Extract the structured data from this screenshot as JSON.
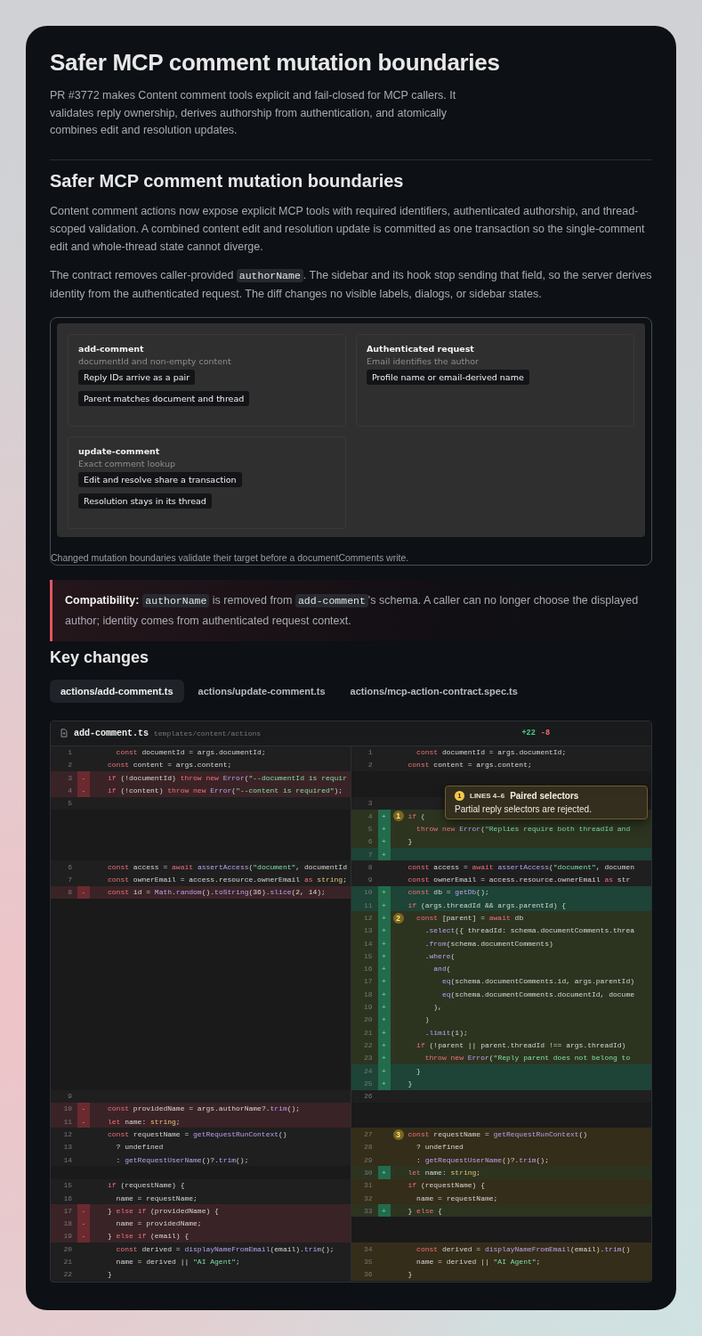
{
  "page": {
    "title": "Safer MCP comment mutation boundaries",
    "summary": "PR #3772 makes Content comment tools explicit and fail-closed for MCP callers. It validates reply ownership, derives authorship from authentication, and atomically combines edit and resolution updates."
  },
  "section": {
    "heading": "Safer MCP comment mutation boundaries",
    "paragraphs": [
      [
        {
          "kind": "text",
          "text": "Content comment actions now expose explicit MCP tools with required identifiers, authenticated authorship, and thread-scoped validation. A combined content edit and resolution update is committed as one transaction so the single-comment edit and whole-thread state cannot diverge."
        }
      ],
      [
        {
          "kind": "text",
          "text": "The contract removes caller-provided "
        },
        {
          "kind": "code",
          "text": "authorName"
        },
        {
          "kind": "text",
          "text": ". The sidebar and its hook stop sending that field, so the server derives identity from the authenticated request. The diff changes no visible labels, dialogs, or sidebar states."
        }
      ]
    ]
  },
  "diagram": {
    "cards": [
      {
        "title": "add-comment",
        "subtitle": "documentId and non-empty content",
        "chips": [
          "Reply IDs arrive as a pair",
          "Parent matches document and thread"
        ]
      },
      {
        "title": "Authenticated request",
        "subtitle": "Email identifies the author",
        "chips": [
          "Profile name or email-derived name"
        ]
      },
      {
        "title": "update-comment",
        "subtitle": "Exact comment lookup",
        "chips": [
          "Edit and resolve share a transaction",
          "Resolution stays in its thread"
        ]
      }
    ],
    "caption": "Changed mutation boundaries validate their target before a documentComments write."
  },
  "callout": {
    "segments": [
      {
        "kind": "bold",
        "text": "Compatibility:"
      },
      {
        "kind": "code",
        "text": "authorName"
      },
      {
        "kind": "text",
        "text": " is removed from "
      },
      {
        "kind": "code",
        "text": "add-comment"
      },
      {
        "kind": "text",
        "text": "'s schema. A caller can no longer choose the displayed author; identity comes from authenticated request context."
      }
    ]
  },
  "key_changes": {
    "heading": "Key changes",
    "tabs": [
      {
        "label": "actions/add-comment.ts",
        "selected": true
      },
      {
        "label": "actions/update-comment.ts",
        "selected": false
      },
      {
        "label": "actions/mcp-action-contract.spec.ts",
        "selected": false
      }
    ]
  },
  "diff": {
    "file_name": "add-comment.ts",
    "path": "templates/content/actions",
    "additions": "+22",
    "deletions": "-8",
    "tooltip": {
      "marker": "1",
      "lines_label": "LINES 4–6",
      "title": "Paired selectors",
      "body": "Partial reply selectors are rejected."
    },
    "rows": [
      {
        "left": {
          "kind": "ctx",
          "num": "1",
          "code": "  const documentId = args.documentId;"
        },
        "right": {
          "kind": "ctx",
          "num": "1",
          "code": "  const documentId = args.documentId;"
        }
      },
      {
        "left": {
          "kind": "ctx",
          "num": "2",
          "code": "const content = args.content;"
        },
        "right": {
          "kind": "ctx",
          "num": "2",
          "code": "const content = args.content;"
        }
      },
      {
        "left": {
          "kind": "del",
          "num": "3",
          "sign": "-",
          "code": "if (!documentId) throw new Error(\"--documentId is requir"
        },
        "right": {
          "kind": "empty"
        }
      },
      {
        "left": {
          "kind": "del",
          "num": "4",
          "sign": "-",
          "code": "if (!content) throw new Error(\"--content is required\");"
        },
        "right": {
          "kind": "empty"
        }
      },
      {
        "left": {
          "kind": "ctx",
          "num": "5"
        },
        "right": {
          "kind": "ctx",
          "num": "3"
        }
      },
      {
        "left": {
          "kind": "empty"
        },
        "right": {
          "kind": "add",
          "num": "4",
          "sign": "+",
          "marker": "1",
          "annotated": true,
          "code": "if ("
        }
      },
      {
        "left": {
          "kind": "empty"
        },
        "right": {
          "kind": "add",
          "num": "5",
          "sign": "+",
          "annotated": true,
          "code": "  throw new Error(\"Replies require both threadId and"
        }
      },
      {
        "left": {
          "kind": "empty"
        },
        "right": {
          "kind": "add",
          "num": "6",
          "sign": "+",
          "annotated": true,
          "code": "}"
        }
      },
      {
        "left": {
          "kind": "empty"
        },
        "right": {
          "kind": "add",
          "num": "7",
          "sign": "+",
          "annotated": false
        }
      },
      {
        "left": {
          "kind": "ctx",
          "num": "6",
          "code": "const access = await assertAccess(\"document\", documentId"
        },
        "right": {
          "kind": "ctx",
          "num": "8",
          "code": "const access = await assertAccess(\"document\", documen"
        }
      },
      {
        "left": {
          "kind": "ctx",
          "num": "7",
          "code": "const ownerEmail = access.resource.ownerEmail as string;"
        },
        "right": {
          "kind": "ctx",
          "num": "9",
          "code": "const ownerEmail = access.resource.ownerEmail as str"
        }
      },
      {
        "left": {
          "kind": "del",
          "num": "8",
          "sign": "-",
          "code": "const id = Math.random().toString(36).slice(2, 14);"
        },
        "right": {
          "kind": "add",
          "num": "10",
          "sign": "+",
          "annotated": false,
          "code": "const db = getDb();"
        }
      },
      {
        "left": {
          "kind": "empty"
        },
        "right": {
          "kind": "add",
          "num": "11",
          "sign": "+",
          "annotated": false,
          "code": "if (args.threadId && args.parentId) {"
        }
      },
      {
        "left": {
          "kind": "empty"
        },
        "right": {
          "kind": "add",
          "num": "12",
          "sign": "+",
          "marker": "2",
          "annotated": true,
          "code": "  const [parent] = await db"
        }
      },
      {
        "left": {
          "kind": "empty"
        },
        "right": {
          "kind": "add",
          "num": "13",
          "sign": "+",
          "annotated": true,
          "code": "    .select({ threadId: schema.documentComments.threa"
        }
      },
      {
        "left": {
          "kind": "empty"
        },
        "right": {
          "kind": "add",
          "num": "14",
          "sign": "+",
          "annotated": true,
          "code": "    .from(schema.documentComments)"
        }
      },
      {
        "left": {
          "kind": "empty"
        },
        "right": {
          "kind": "add",
          "num": "15",
          "sign": "+",
          "annotated": true,
          "code": "    .where("
        }
      },
      {
        "left": {
          "kind": "empty"
        },
        "right": {
          "kind": "add",
          "num": "16",
          "sign": "+",
          "annotated": true,
          "code": "      and("
        }
      },
      {
        "left": {
          "kind": "empty"
        },
        "right": {
          "kind": "add",
          "num": "17",
          "sign": "+",
          "annotated": true,
          "code": "        eq(schema.documentComments.id, args.parentId)"
        }
      },
      {
        "left": {
          "kind": "empty"
        },
        "right": {
          "kind": "add",
          "num": "18",
          "sign": "+",
          "annotated": true,
          "code": "        eq(schema.documentComments.documentId, docume"
        }
      },
      {
        "left": {
          "kind": "empty"
        },
        "right": {
          "kind": "add",
          "num": "19",
          "sign": "+",
          "annotated": true,
          "code": "      ),"
        }
      },
      {
        "left": {
          "kind": "empty"
        },
        "right": {
          "kind": "add",
          "num": "20",
          "sign": "+",
          "annotated": true,
          "code": "    )"
        }
      },
      {
        "left": {
          "kind": "empty"
        },
        "right": {
          "kind": "add",
          "num": "21",
          "sign": "+",
          "annotated": true,
          "code": "    .limit(1);"
        }
      },
      {
        "left": {
          "kind": "empty"
        },
        "right": {
          "kind": "add",
          "num": "22",
          "sign": "+",
          "annotated": true,
          "code": "  if (!parent || parent.threadId !== args.threadId)"
        }
      },
      {
        "left": {
          "kind": "empty"
        },
        "right": {
          "kind": "add",
          "num": "23",
          "sign": "+",
          "annotated": true,
          "code": "    throw new Error(\"Reply parent does not belong to"
        }
      },
      {
        "left": {
          "kind": "empty"
        },
        "right": {
          "kind": "add",
          "num": "24",
          "sign": "+",
          "annotated": false,
          "code": "  }"
        }
      },
      {
        "left": {
          "kind": "empty"
        },
        "right": {
          "kind": "add",
          "num": "25",
          "sign": "+",
          "annotated": false,
          "code": "}"
        }
      },
      {
        "left": {
          "kind": "ctx",
          "num": "9"
        },
        "right": {
          "kind": "ctx",
          "num": "26"
        }
      },
      {
        "left": {
          "kind": "del",
          "num": "10",
          "sign": "-",
          "code": "const providedName = args.authorName?.trim();"
        },
        "right": {
          "kind": "empty"
        }
      },
      {
        "left": {
          "kind": "del",
          "num": "11",
          "sign": "-",
          "code": "let name: string;"
        },
        "right": {
          "kind": "empty"
        }
      },
      {
        "left": {
          "kind": "ctx",
          "num": "12",
          "code": "const requestName = getRequestRunContext()"
        },
        "right": {
          "kind": "ctx",
          "num": "27",
          "marker": "3",
          "annotated": true,
          "code": "const requestName = getRequestRunContext()"
        }
      },
      {
        "left": {
          "kind": "ctx",
          "num": "13",
          "code": "  ? undefined"
        },
        "right": {
          "kind": "ctx",
          "num": "28",
          "annotated": true,
          "code": "  ? undefined"
        }
      },
      {
        "left": {
          "kind": "ctx",
          "num": "14",
          "code": "  : getRequestUserName()?.trim();"
        },
        "right": {
          "kind": "ctx",
          "num": "29",
          "annotated": true,
          "code": "  : getRequestUserName()?.trim();"
        }
      },
      {
        "left": {
          "kind": "empty"
        },
        "right": {
          "kind": "add",
          "num": "30",
          "sign": "+",
          "annotated": true,
          "code": "let name: string;"
        }
      },
      {
        "left": {
          "kind": "ctx",
          "num": "15",
          "code": "if (requestName) {"
        },
        "right": {
          "kind": "ctx",
          "num": "31",
          "annotated": true,
          "code": "if (requestName) {"
        }
      },
      {
        "left": {
          "kind": "ctx",
          "num": "16",
          "code": "  name = requestName;"
        },
        "right": {
          "kind": "ctx",
          "num": "32",
          "annotated": true,
          "code": "  name = requestName;"
        }
      },
      {
        "left": {
          "kind": "del",
          "num": "17",
          "sign": "-",
          "code": "} else if (providedName) {"
        },
        "right": {
          "kind": "add",
          "num": "33",
          "sign": "+",
          "annotated": true,
          "code": "} else {"
        }
      },
      {
        "left": {
          "kind": "del",
          "num": "18",
          "sign": "-",
          "code": "  name = providedName;"
        },
        "right": {
          "kind": "empty"
        }
      },
      {
        "left": {
          "kind": "del",
          "num": "19",
          "sign": "-",
          "code": "} else if (email) {"
        },
        "right": {
          "kind": "empty"
        }
      },
      {
        "left": {
          "kind": "ctx",
          "num": "20",
          "code": "  const derived = displayNameFromEmail(email).trim();"
        },
        "right": {
          "kind": "ctx",
          "num": "34",
          "annotated": true,
          "code": "  const derived = displayNameFromEmail(email).trim()"
        }
      },
      {
        "left": {
          "kind": "ctx",
          "num": "21",
          "code": "  name = derived || \"AI Agent\";"
        },
        "right": {
          "kind": "ctx",
          "num": "35",
          "annotated": true,
          "code": "  name = derived || \"AI Agent\";"
        }
      },
      {
        "left": {
          "kind": "ctx",
          "num": "22",
          "code": "}"
        },
        "right": {
          "kind": "ctx",
          "num": "36",
          "annotated": true,
          "code": "}"
        }
      }
    ]
  }
}
